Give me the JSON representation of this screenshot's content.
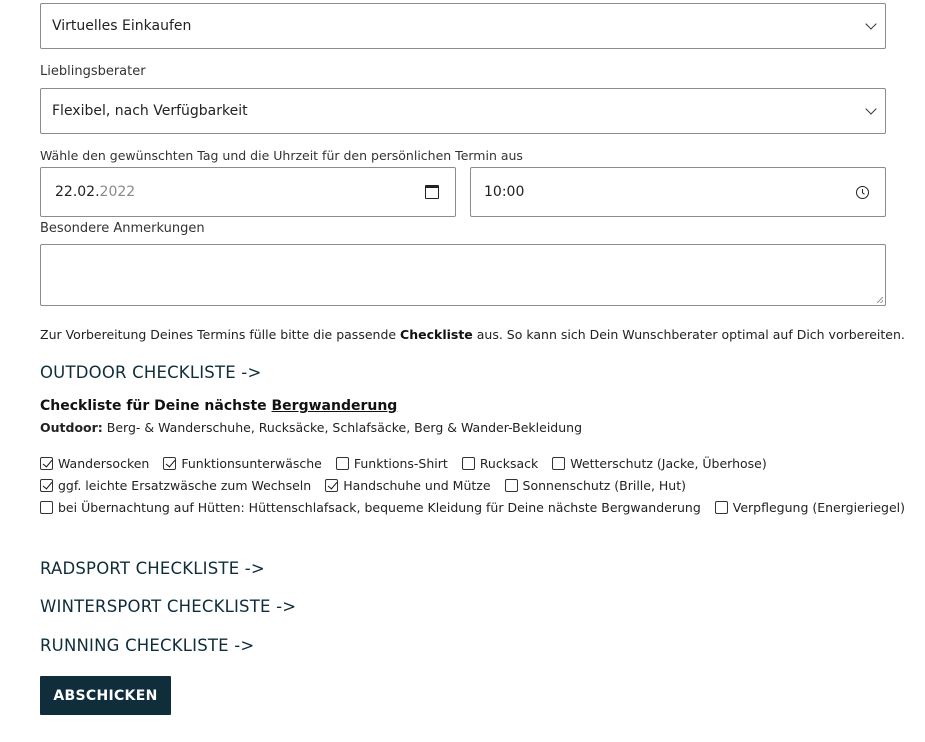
{
  "form": {
    "type_select": {
      "value": "Virtuelles Einkaufen"
    },
    "advisor": {
      "label": "Lieblingsberater",
      "value": "Flexibel, nach Verfügbarkeit"
    },
    "datetime": {
      "label": "Wähle den gewünschten Tag und die Uhrzeit für den persönlichen Termin aus",
      "date_daymonth": "22.02.",
      "date_year": "2022",
      "time": "10:00"
    },
    "notes": {
      "label": "Besondere Anmerkungen",
      "value": ""
    },
    "info": {
      "before": "Zur Vorbereitung Deines Termins fülle bitte die passende ",
      "bold": "Checkliste",
      "after": " aus. So kann sich Dein Wunschberater optimal auf Dich vorbereiten."
    }
  },
  "checklists": {
    "outdoor": {
      "heading": "OUTDOOR CHECKLISTE ->",
      "title_prefix": "Checkliste für Deine nächste ",
      "title_link": "Bergwanderung",
      "sub_label": "Outdoor:",
      "sub_text": " Berg- & Wanderschuhe, Rucksäcke, Schlafsäcke, Berg & Wander-Bekleidung",
      "rows": [
        [
          {
            "label": "Wandersocken",
            "checked": true
          },
          {
            "label": "Funktionsunterwäsche",
            "checked": true
          },
          {
            "label": "Funktions-Shirt",
            "checked": false
          },
          {
            "label": "Rucksack",
            "checked": false
          },
          {
            "label": "Wetterschutz (Jacke, Überhose)",
            "checked": false
          }
        ],
        [
          {
            "label": "ggf. leichte Ersatzwäsche zum Wechseln",
            "checked": true
          },
          {
            "label": "Handschuhe und Mütze",
            "checked": true
          },
          {
            "label": "Sonnenschutz (Brille, Hut)",
            "checked": false
          }
        ],
        [
          {
            "label": "bei Übernachtung auf Hütten: Hüttenschlafsack, bequeme Kleidung für Deine nächste Bergwanderung",
            "checked": false
          },
          {
            "label": "Verpflegung (Energieriegel)",
            "checked": false
          }
        ]
      ]
    },
    "radsport": {
      "heading": "RADSPORT CHECKLISTE ->"
    },
    "wintersport": {
      "heading": "WINTERSPORT CHECKLISTE ->"
    },
    "running": {
      "heading": "RUNNING CHECKLISTE ->"
    }
  },
  "submit_label": "ABSCHICKEN",
  "colors": {
    "accent": "#0f2d3a",
    "border": "#8c8c8c"
  }
}
